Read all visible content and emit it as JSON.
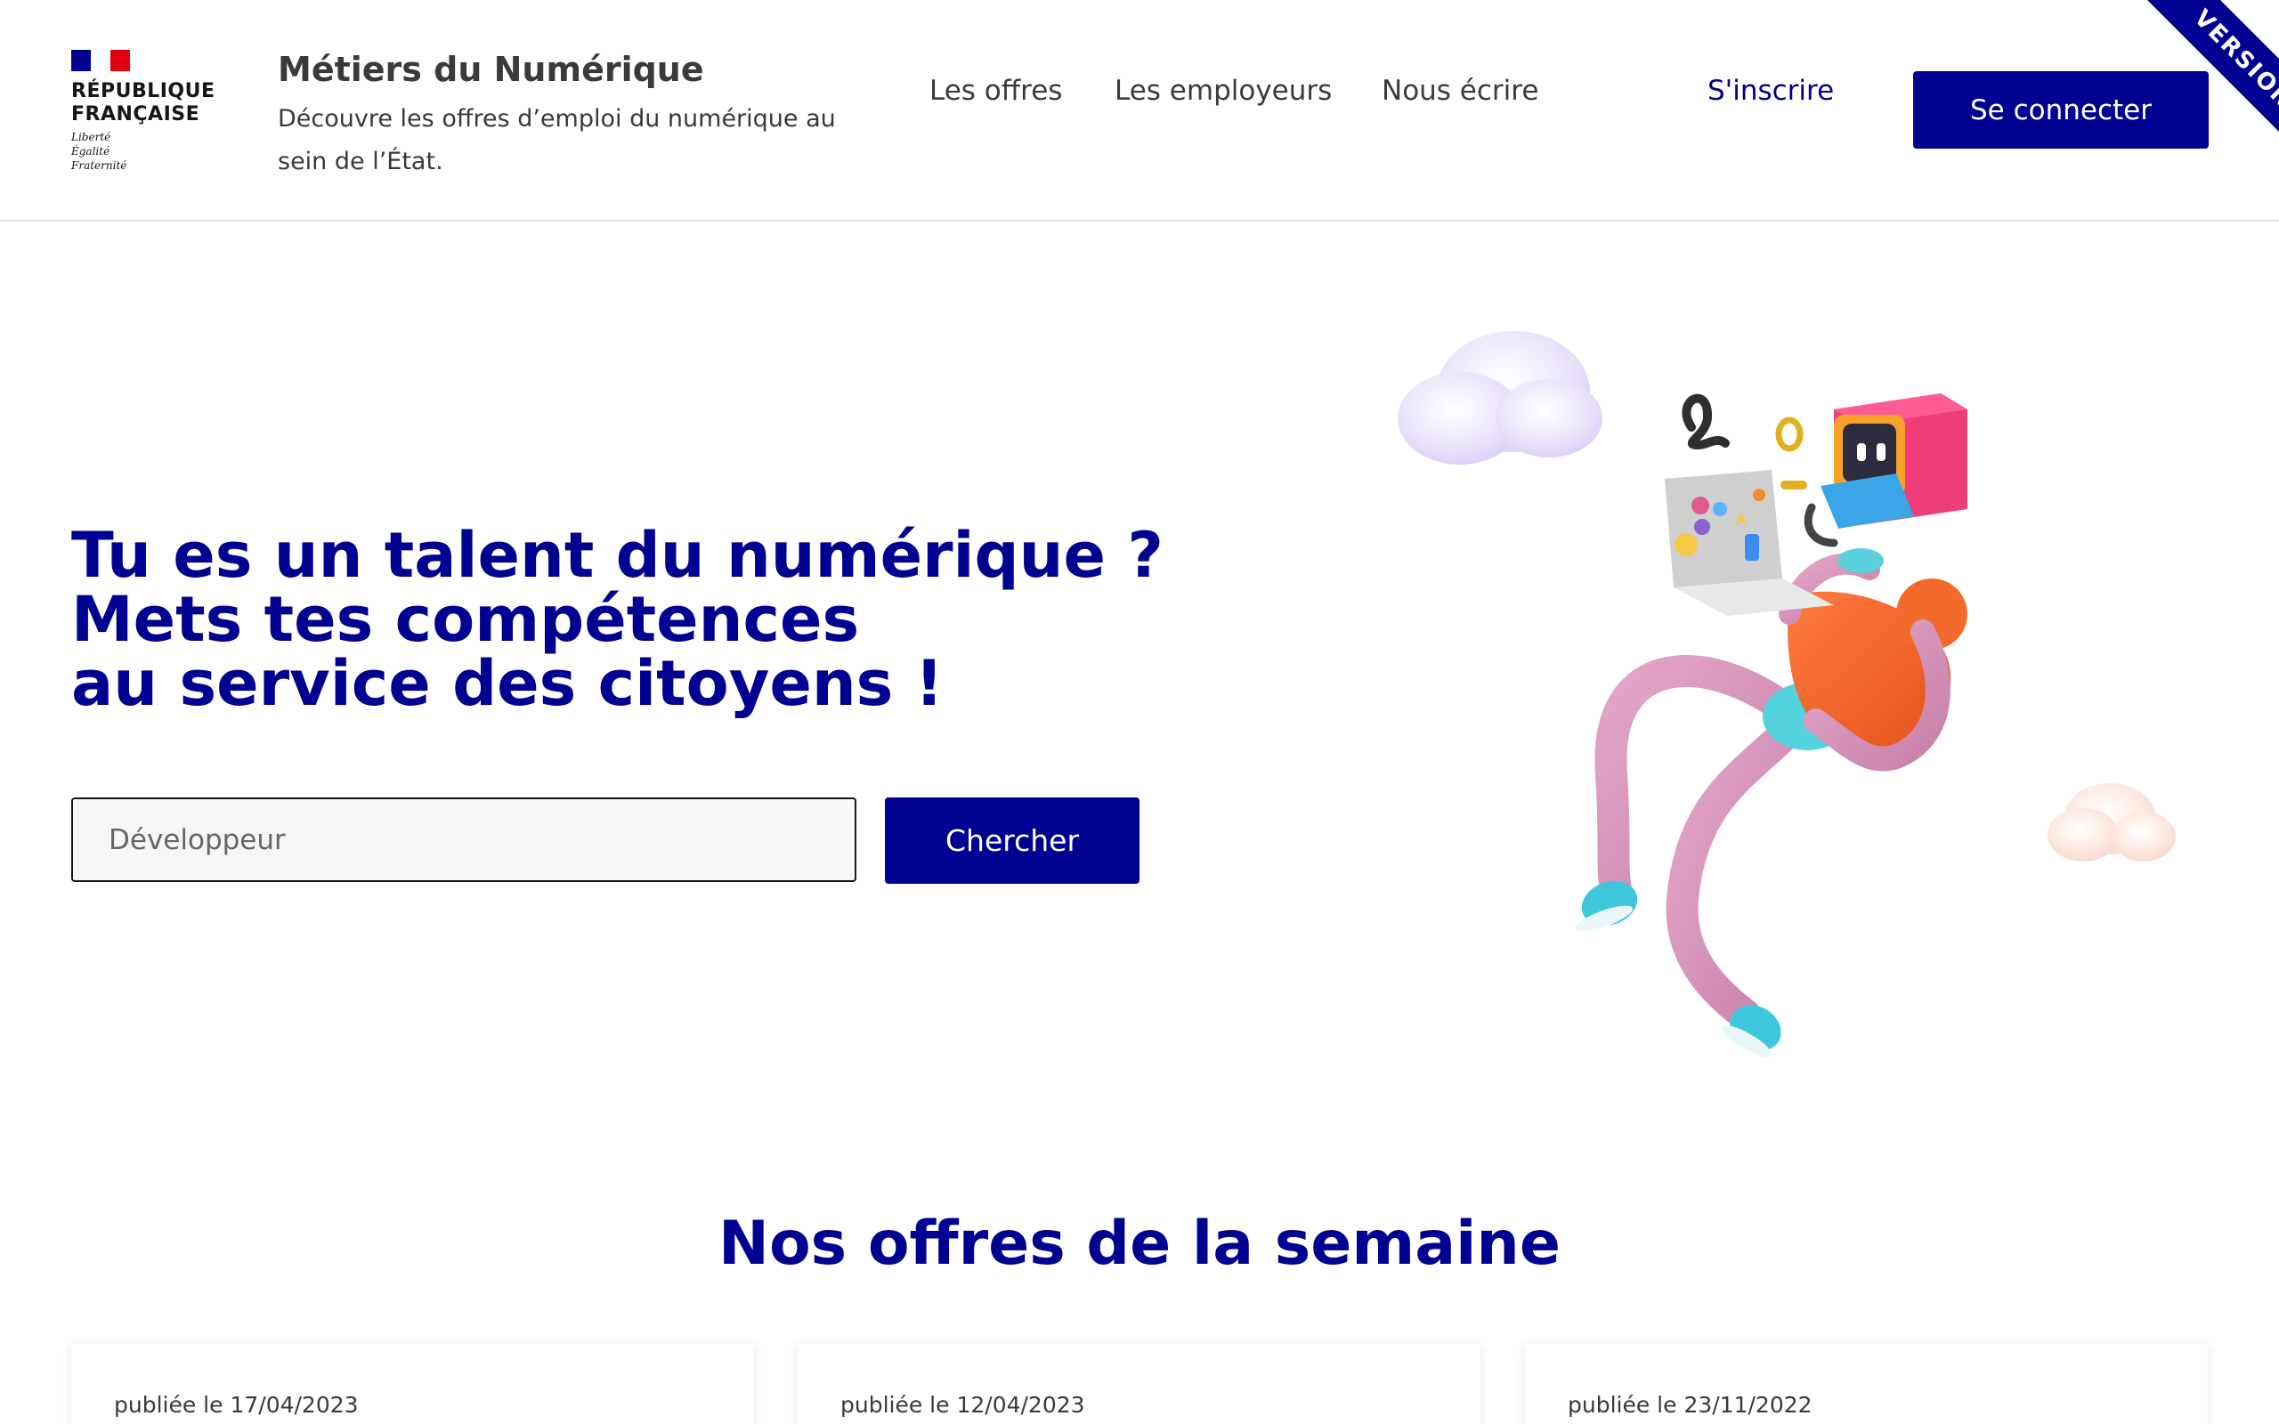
{
  "brand": {
    "logo_lines": [
      "République",
      "Française"
    ],
    "motto": [
      "Liberté",
      "Égalité",
      "Fraternité"
    ],
    "colors": {
      "blue": "#000091",
      "red": "#e1000f"
    }
  },
  "header": {
    "title": "Métiers du Numérique",
    "tagline": "Découvre les offres d’emploi du numérique au sein de l’État.",
    "nav": [
      "Les offres",
      "Les employeurs",
      "Nous écrire"
    ],
    "signup": "S'inscrire",
    "login": "Se connecter",
    "ribbon": "VERSION"
  },
  "hero": {
    "title_lines": [
      "Tu es un talent du numérique ?",
      "Mets tes compétences",
      "au service des citoyens !"
    ],
    "search_placeholder": "Développeur",
    "search_button": "Chercher",
    "illustration": "3d-character-with-laptop-icon"
  },
  "offers": {
    "title": "Nos offres de la semaine",
    "cards": [
      {
        "date": "publiée le 17/04/2023"
      },
      {
        "date": "publiée le 12/04/2023"
      },
      {
        "date": "publiée le 23/11/2022"
      }
    ]
  },
  "accent_color": "#000091"
}
